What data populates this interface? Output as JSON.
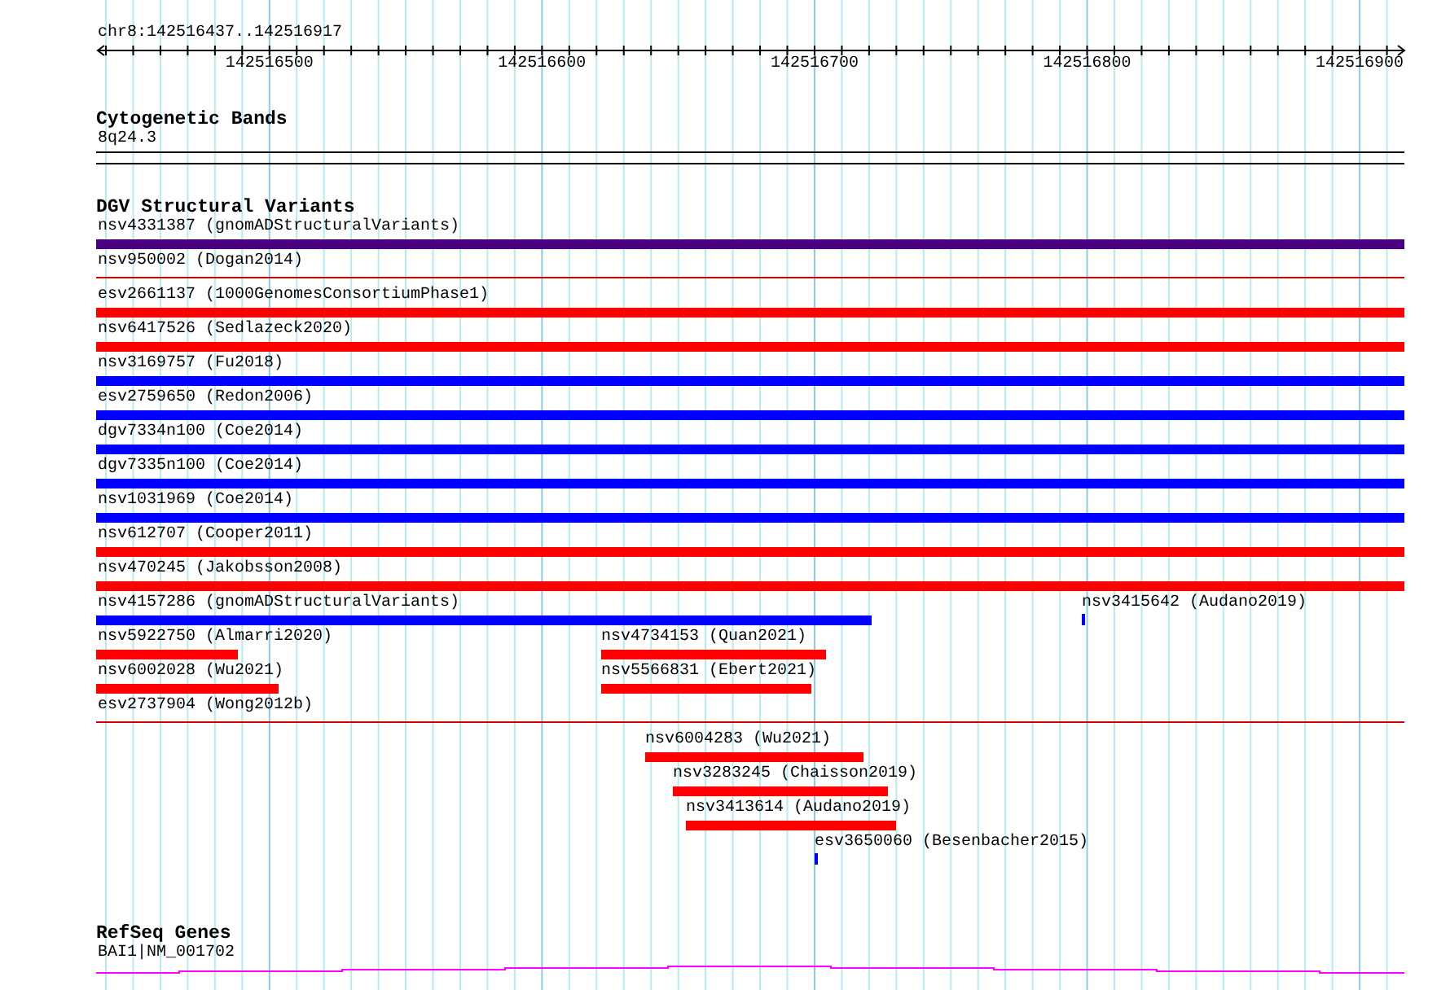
{
  "ruler": {
    "location": "chr8:142516437..142516917",
    "tick_labels": [
      "142516500",
      "142516600",
      "142516700",
      "142516800",
      "142516900"
    ]
  },
  "cytogenetic_bands": {
    "title": "Cytogenetic Bands",
    "band": "8q24.3"
  },
  "dgv": {
    "title": "DGV Structural Variants",
    "variants": [
      {
        "label": "nsv4331387 (gnomADStructuralVariants)",
        "color": "#4b0082",
        "kind": "bar"
      },
      {
        "label": "nsv950002 (Dogan2014)",
        "color": "#cc0000",
        "kind": "line"
      },
      {
        "label": "esv2661137 (1000GenomesConsortiumPhase1)",
        "color": "#ff0000",
        "kind": "bar"
      },
      {
        "label": "nsv6417526 (Sedlazeck2020)",
        "color": "#ff0000",
        "kind": "bar"
      },
      {
        "label": "nsv3169757 (Fu2018)",
        "color": "#0000ff",
        "kind": "bar"
      },
      {
        "label": "esv2759650 (Redon2006)",
        "color": "#0000ff",
        "kind": "bar"
      },
      {
        "label": "dgv7334n100 (Coe2014)",
        "color": "#0000ff",
        "kind": "bar"
      },
      {
        "label": "dgv7335n100 (Coe2014)",
        "color": "#0000ff",
        "kind": "bar"
      },
      {
        "label": "nsv1031969 (Coe2014)",
        "color": "#0000ff",
        "kind": "bar"
      },
      {
        "label": "nsv612707 (Cooper2011)",
        "color": "#ff0000",
        "kind": "bar"
      },
      {
        "label": "nsv470245 (Jakobsson2008)",
        "color": "#ff0000",
        "kind": "bar"
      },
      {
        "label": "nsv4157286 (gnomADStructuralVariants)",
        "color": "#0000ff",
        "kind": "bar"
      },
      {
        "label": "nsv3415642 (Audano2019)",
        "color": "#0000ff",
        "kind": "mark"
      },
      {
        "label": "nsv5922750 (Almarri2020)",
        "color": "#ff0000",
        "kind": "bar"
      },
      {
        "label": "nsv4734153 (Quan2021)",
        "color": "#ff0000",
        "kind": "bar"
      },
      {
        "label": "nsv6002028 (Wu2021)",
        "color": "#ff0000",
        "kind": "bar"
      },
      {
        "label": "nsv5566831 (Ebert2021)",
        "color": "#ff0000",
        "kind": "bar"
      },
      {
        "label": "esv2737904 (Wong2012b)",
        "color": "#cc0000",
        "kind": "line"
      },
      {
        "label": "nsv6004283 (Wu2021)",
        "color": "#ff0000",
        "kind": "bar"
      },
      {
        "label": "nsv3283245 (Chaisson2019)",
        "color": "#ff0000",
        "kind": "bar"
      },
      {
        "label": "nsv3413614 (Audano2019)",
        "color": "#ff0000",
        "kind": "bar"
      },
      {
        "label": "esv3650060 (Besenbacher2015)",
        "color": "#0000ff",
        "kind": "mark"
      }
    ]
  },
  "refseq_genes": {
    "title": "RefSeq Genes",
    "gene": "BAI1|NM_001702"
  }
}
